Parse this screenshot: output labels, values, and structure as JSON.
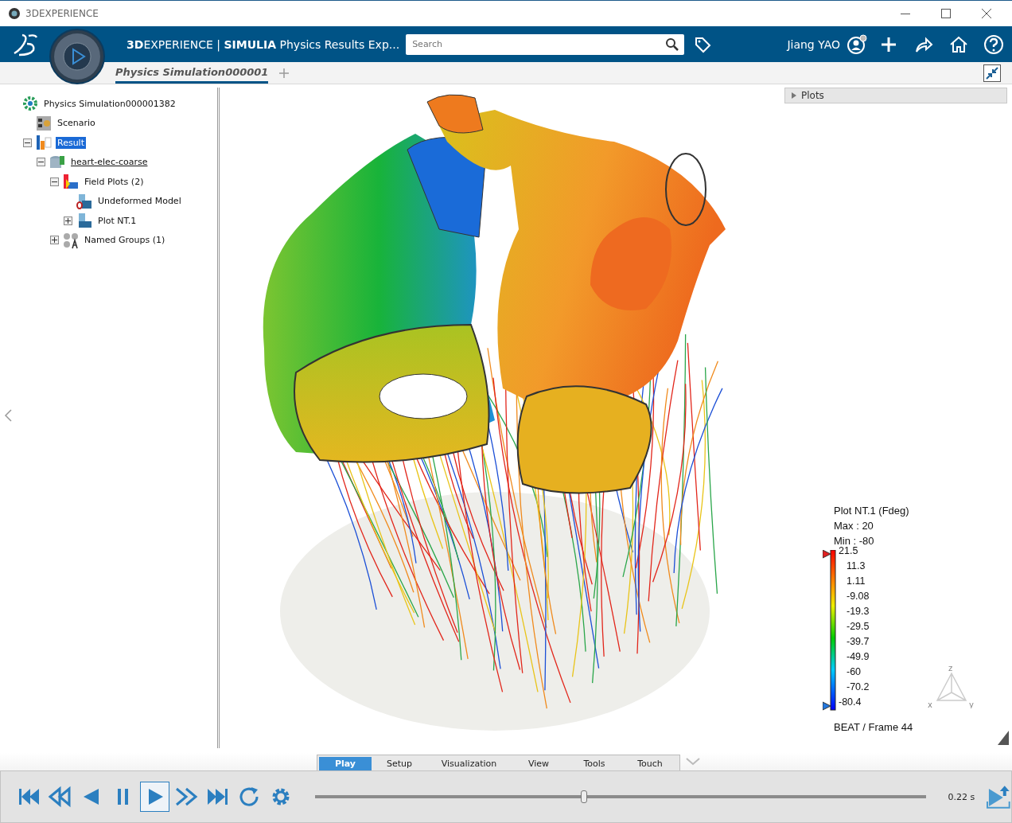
{
  "window": {
    "title": "3DEXPERIENCE"
  },
  "header": {
    "title": "**3D**EXPERIENCE | **SIMULIA** Physics Results Exp...",
    "search": {
      "placeholder": "Search"
    },
    "user": "Jiang YAO"
  },
  "tabs": [
    {
      "label": "Physics Simulation000001",
      "selected": true
    }
  ],
  "tree": [
    {
      "label": "Physics Simulation000001382",
      "kind": "simulation",
      "selected": false,
      "children": [
        {
          "label": "Scenario",
          "kind": "scenario",
          "selected": false
        },
        {
          "label": "Result",
          "kind": "result",
          "selected": true,
          "expanded": true,
          "children": [
            {
              "label": "heart-elec-coarse",
              "kind": "dataset",
              "selected": false,
              "expanded": true,
              "children": [
                {
                  "label": "Field Plots (2)",
                  "kind": "field-plots",
                  "selected": false,
                  "expanded": true,
                  "children": [
                    {
                      "label": "Undeformed Model",
                      "kind": "model",
                      "selected": false
                    },
                    {
                      "label": "Plot NT.1",
                      "kind": "plot",
                      "selected": false,
                      "expanded": false
                    }
                  ]
                },
                {
                  "label": "Named Groups (1)",
                  "kind": "groups",
                  "selected": false,
                  "expanded": false
                }
              ]
            }
          ]
        }
      ]
    }
  ],
  "plots_panel": {
    "title": "Plots"
  },
  "legend": {
    "title": "Plot NT.1 (Fdeg)",
    "max": "Max : 20",
    "min": "Min : -80",
    "ticks": [
      "21.5",
      "11.3",
      "1.11",
      "-9.08",
      "-19.3",
      "-29.5",
      "-39.7",
      "-49.9",
      "-60",
      "-70.2",
      "-80.4"
    ],
    "footer": "BEAT / Frame 44"
  },
  "axis_labels": [
    "z",
    "x",
    "y"
  ],
  "toolbar": {
    "tabs": [
      {
        "label": "Play",
        "selected": true
      },
      {
        "label": "Setup",
        "selected": false
      },
      {
        "label": "Visualization",
        "selected": false
      },
      {
        "label": "View",
        "selected": false
      },
      {
        "label": "Tools",
        "selected": false
      },
      {
        "label": "Touch",
        "selected": false
      }
    ],
    "buttons": [
      {
        "kind": "first",
        "selected": false
      },
      {
        "kind": "rewind",
        "selected": false
      },
      {
        "kind": "back",
        "selected": false
      },
      {
        "kind": "pause",
        "selected": false
      },
      {
        "kind": "play",
        "selected": true
      },
      {
        "kind": "forward",
        "selected": false
      },
      {
        "kind": "last",
        "selected": false
      },
      {
        "kind": "loop",
        "selected": false
      },
      {
        "kind": "settings",
        "selected": false
      }
    ],
    "slider": {
      "level": 0.44
    },
    "time": "0.22 s"
  }
}
